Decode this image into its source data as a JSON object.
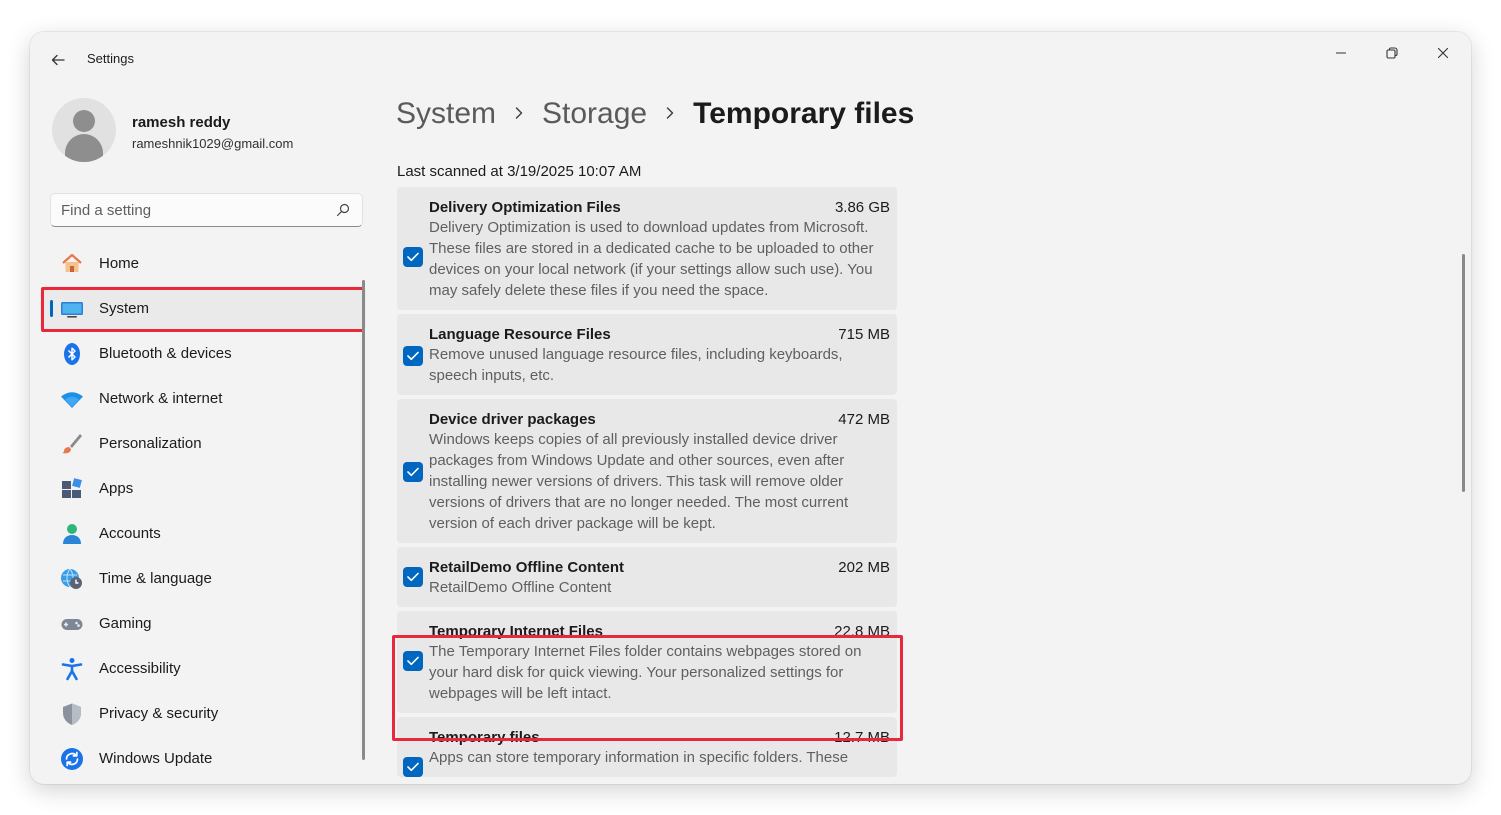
{
  "window": {
    "title": "Settings"
  },
  "profile": {
    "name": "ramesh reddy",
    "email": "rameshnik1029@gmail.com"
  },
  "search": {
    "placeholder": "Find a setting"
  },
  "sidebar": {
    "items": [
      {
        "label": "Home",
        "icon": "home-icon"
      },
      {
        "label": "System",
        "icon": "monitor-icon",
        "selected": true
      },
      {
        "label": "Bluetooth & devices",
        "icon": "bluetooth-icon"
      },
      {
        "label": "Network & internet",
        "icon": "wifi-icon"
      },
      {
        "label": "Personalization",
        "icon": "brush-icon"
      },
      {
        "label": "Apps",
        "icon": "apps-icon"
      },
      {
        "label": "Accounts",
        "icon": "person-icon"
      },
      {
        "label": "Time & language",
        "icon": "globe-clock-icon"
      },
      {
        "label": "Gaming",
        "icon": "gamepad-icon"
      },
      {
        "label": "Accessibility",
        "icon": "accessibility-icon"
      },
      {
        "label": "Privacy & security",
        "icon": "shield-icon"
      },
      {
        "label": "Windows Update",
        "icon": "update-icon"
      }
    ]
  },
  "breadcrumb": {
    "items": [
      "System",
      "Storage",
      "Temporary files"
    ]
  },
  "main": {
    "scan_label": "Last scanned at 3/19/2025 10:07 AM",
    "items": [
      {
        "title": "Delivery Optimization Files",
        "size": "3.86 GB",
        "checked": true,
        "description": "Delivery Optimization is used to download updates from Microsoft. These files are stored in a dedicated cache to be uploaded to other devices on your local network (if your settings allow such use). You may safely delete these files if you need the space."
      },
      {
        "title": "Language Resource Files",
        "size": "715 MB",
        "checked": true,
        "description": "Remove unused language resource files, including keyboards, speech inputs, etc."
      },
      {
        "title": "Device driver packages",
        "size": "472 MB",
        "checked": true,
        "description": "Windows keeps copies of all previously installed device driver packages from Windows Update and other sources, even after installing newer versions of drivers. This task will remove older versions of drivers that are no longer needed. The most current version of each driver package will be kept."
      },
      {
        "title": "RetailDemo Offline Content",
        "size": "202 MB",
        "checked": true,
        "description": "RetailDemo Offline Content"
      },
      {
        "title": "Temporary Internet Files",
        "size": "22.8 MB",
        "checked": true,
        "description": "The Temporary Internet Files folder contains webpages stored on your hard disk for quick viewing. Your personalized settings for webpages will be left intact."
      },
      {
        "title": "Temporary files",
        "size": "12.7 MB",
        "checked": true,
        "description": "Apps can store temporary information in specific folders. These"
      }
    ]
  },
  "colors": {
    "accent": "#0067c0",
    "highlight": "#e8283b"
  }
}
